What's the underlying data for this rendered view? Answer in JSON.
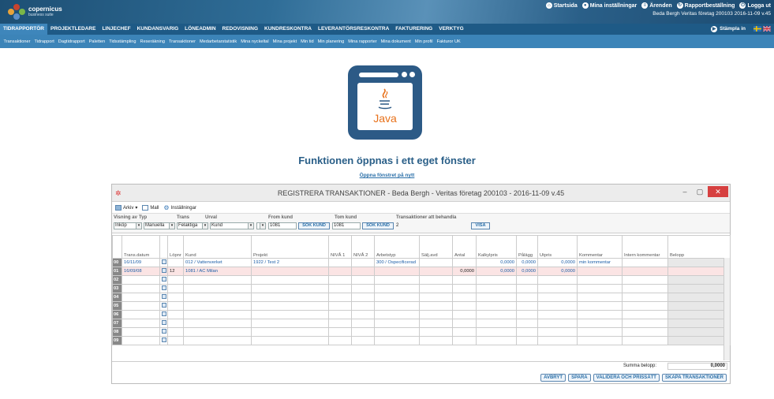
{
  "app": {
    "brand": "copernicus",
    "brand_sub": "business suite"
  },
  "toplinks": [
    "Startsida",
    "Mina inställningar",
    "Ärenden",
    "Rapportbeställning",
    "Logga ut"
  ],
  "userinfo": "Beda Bergh  Veritas företag 200103   2016-11-09  v.45",
  "nav": [
    "TIDRAPPORTÖR",
    "PROJEKTLEDARE",
    "LINJECHEF",
    "KUNDANSVARIG",
    "LÖNEADMIN",
    "REDOVISNING",
    "KUNDRESKONTRA",
    "LEVERANTÖRSRESKONTRA",
    "FAKTURERING",
    "VERKTYG"
  ],
  "stampla": "Stämpla in",
  "subnav": [
    "Transaktioner",
    "Tidrapport",
    "Dagtidrapport",
    "Paletten",
    "Tidsstämpling",
    "Reseräkning",
    "Transaktioner",
    "Medarbetarstatistik",
    "Mina nyckeltal",
    "Mina projekt",
    "Min tid",
    "Min planering",
    "Mina rapporter",
    "Mina dokument",
    "Min profil",
    "Fakturor UK"
  ],
  "java": {
    "label": "Java"
  },
  "message": "Funktionen öppnas i ett eget fönster",
  "reopen_link": "Öppna fönstret på nytt",
  "window": {
    "title": "REGISTRERA TRANSAKTIONER - Beda Bergh - Veritas företag 200103 - 2016-11-09 v.45"
  },
  "toolbar": {
    "arkiv": "Arkiv",
    "mall": "Mall",
    "installningar": "Inställningar"
  },
  "filters": {
    "visning_label": "Visning av",
    "typ_label": "Typ",
    "trans_label": "Trans",
    "urval_label": "Urval",
    "fromkund_label": "From kund",
    "tomkund_label": "Tom kund",
    "att_label": "Transaktioner att behandla",
    "visning": "Inköp",
    "typ": "Manuella",
    "trans": "Felaktiga",
    "urval": "Kund",
    "urval2": "",
    "fromkund": "1081",
    "tomkund": "1081",
    "sok": "SÖK KUND",
    "att": "2",
    "visa": "VISA"
  },
  "columns": [
    "",
    "Trans.datum",
    "",
    "Löpnr",
    "Kund",
    "Projekt",
    "NIVÅ 1",
    "NIVÅ 2",
    "Arbetstyp",
    "Sälj.avd",
    "Antal",
    "Kalkylpris",
    "Pålägg",
    "Utpris",
    "Kommentar",
    "Intern kommentar",
    "Belopp"
  ],
  "rows": [
    {
      "n": "00",
      "date": "16/11/09",
      "lopnr": "",
      "kund": "012 / Vattenverket",
      "projekt": "1922 / Test 2",
      "arbetstyp": "300 / Ospecificerad",
      "antal": "",
      "kalkyl": "0,0000",
      "palagg": "0,0000",
      "utpris": "0,0000",
      "kommentar": "min kommentar"
    },
    {
      "n": "01",
      "date": "16/09/08",
      "lopnr": "12",
      "kund": "1081 / AC Milan",
      "projekt": "",
      "arbetstyp": "",
      "antal": "0,0000",
      "kalkyl": "0,0000",
      "palagg": "0,0000",
      "utpris": "0,0000",
      "kommentar": ""
    },
    {
      "n": "02"
    },
    {
      "n": "03"
    },
    {
      "n": "04"
    },
    {
      "n": "05"
    },
    {
      "n": "06"
    },
    {
      "n": "07"
    },
    {
      "n": "08"
    },
    {
      "n": "09"
    }
  ],
  "summa": {
    "label": "Summa belopp:",
    "value": "0,0000"
  },
  "actions": [
    "AVBRYT",
    "SPARA",
    "VALIDERA OCH PRISSÄTT",
    "SKAPA TRANSAKTIONER"
  ],
  "colors": {
    "header": "#2a5f88",
    "nav": "#1e5a86",
    "subnav": "#3c84b8",
    "java_orange": "#e8711a"
  }
}
